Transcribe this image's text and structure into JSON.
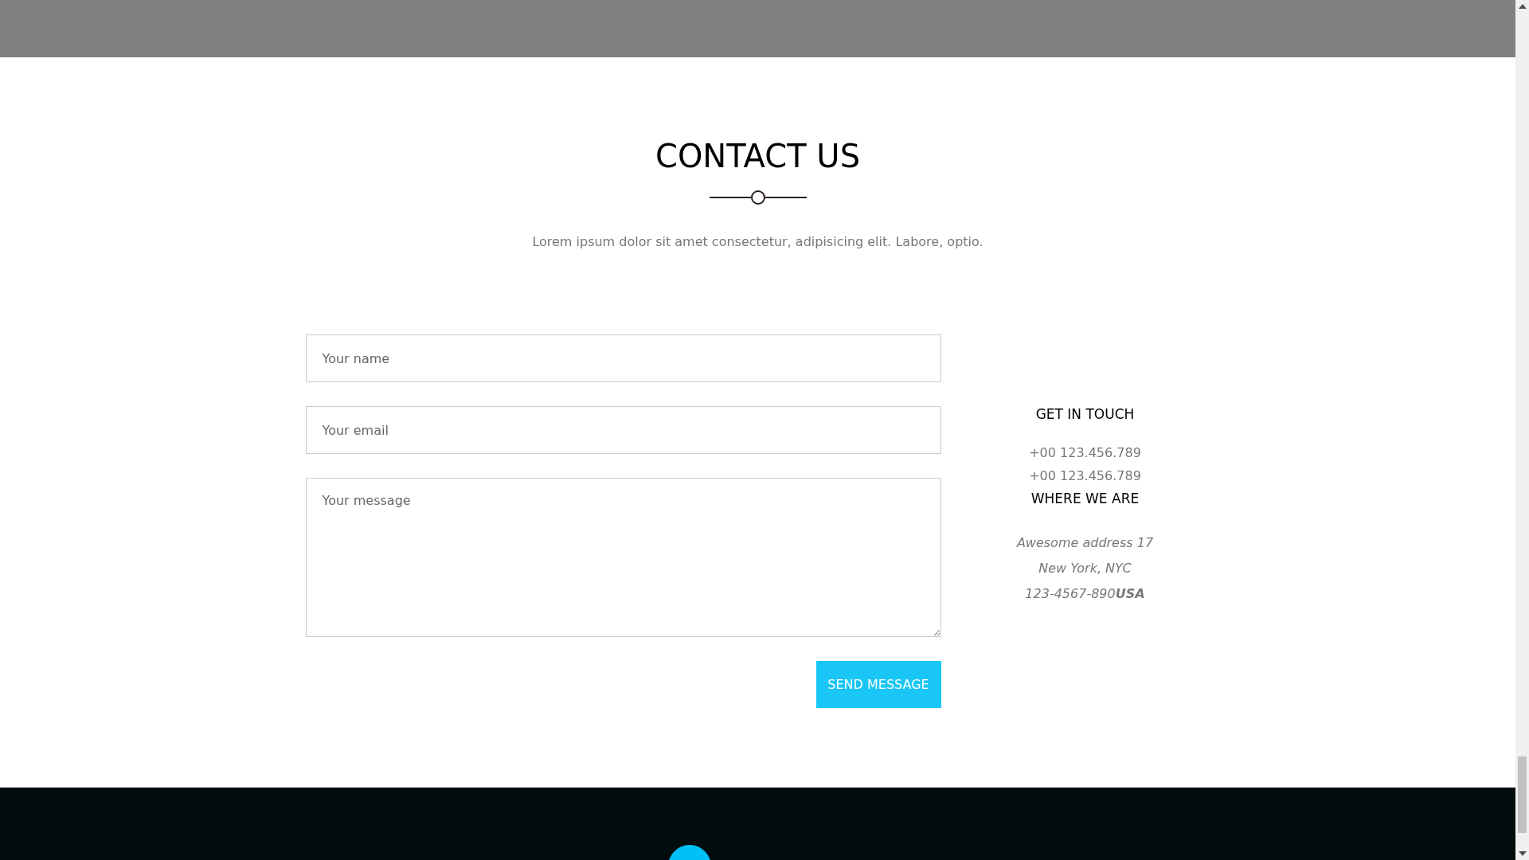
{
  "section": {
    "title": "CONTACT US",
    "intro": "Lorem ipsum dolor sit amet consectetur, adipisicing elit. Labore, optio."
  },
  "form": {
    "fields": [
      {
        "kind": "input",
        "placeholder": "Your name"
      },
      {
        "kind": "input",
        "placeholder": "Your email"
      },
      {
        "kind": "textarea",
        "placeholder": "Your message"
      }
    ],
    "submit": "SEND MESSAGE"
  },
  "info": {
    "blocks": [
      {
        "heading": "GET IN TOUCH",
        "kind": "contact",
        "lines": [
          "+00 123.456.789",
          "+00 123.456.789"
        ]
      },
      {
        "heading": "WHERE WE ARE",
        "kind": "address",
        "lines": [
          "Awesome address 17",
          "New York, NYC",
          "123-4567-890**USA**"
        ]
      }
    ]
  }
}
